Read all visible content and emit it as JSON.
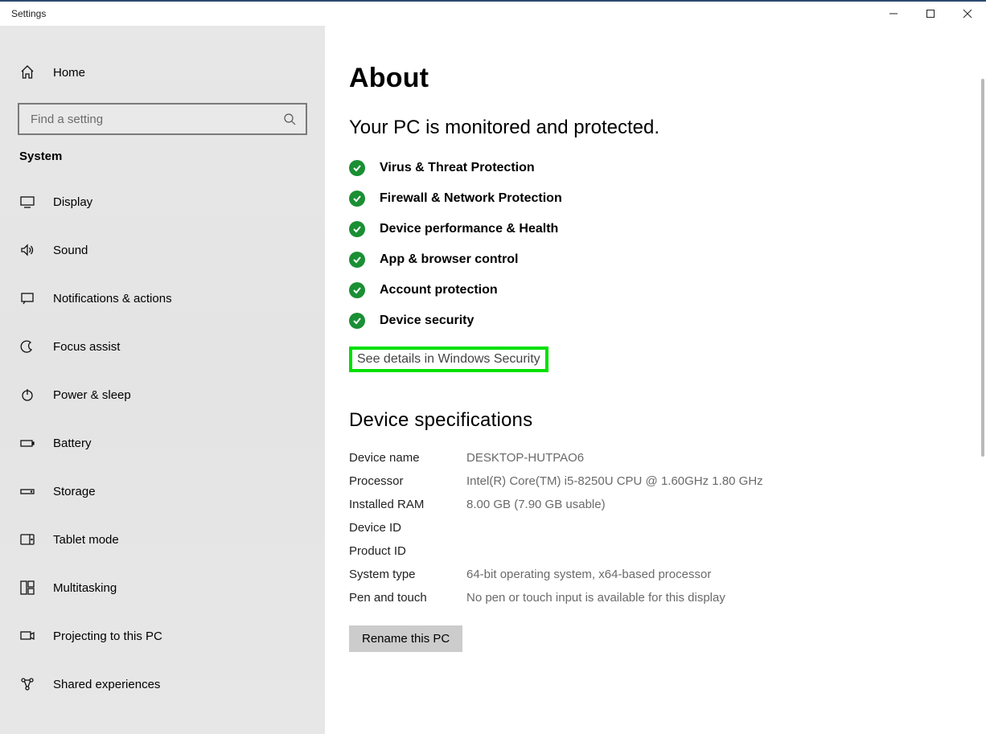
{
  "window": {
    "title": "Settings"
  },
  "sidebar": {
    "home": "Home",
    "search_placeholder": "Find a setting",
    "section": "System",
    "items": [
      {
        "label": "Display"
      },
      {
        "label": "Sound"
      },
      {
        "label": "Notifications & actions"
      },
      {
        "label": "Focus assist"
      },
      {
        "label": "Power & sleep"
      },
      {
        "label": "Battery"
      },
      {
        "label": "Storage"
      },
      {
        "label": "Tablet mode"
      },
      {
        "label": "Multitasking"
      },
      {
        "label": "Projecting to this PC"
      },
      {
        "label": "Shared experiences"
      }
    ]
  },
  "page": {
    "title": "About",
    "subtitle": "Your PC is monitored and protected.",
    "statuses": [
      "Virus & Threat Protection",
      "Firewall & Network Protection",
      "Device performance & Health",
      "App & browser control",
      "Account protection",
      "Device security"
    ],
    "security_link": "See details in Windows Security",
    "specs_title": "Device specifications",
    "specs": [
      {
        "label": "Device name",
        "value": "DESKTOP-HUTPAO6"
      },
      {
        "label": "Processor",
        "value": "Intel(R) Core(TM) i5-8250U CPU @ 1.60GHz   1.80 GHz"
      },
      {
        "label": "Installed RAM",
        "value": "8.00 GB (7.90 GB usable)"
      },
      {
        "label": "Device ID",
        "value": ""
      },
      {
        "label": "Product ID",
        "value": ""
      },
      {
        "label": "System type",
        "value": "64-bit operating system, x64-based processor"
      },
      {
        "label": "Pen and touch",
        "value": "No pen or touch input is available for this display"
      }
    ],
    "rename_button": "Rename this PC"
  }
}
